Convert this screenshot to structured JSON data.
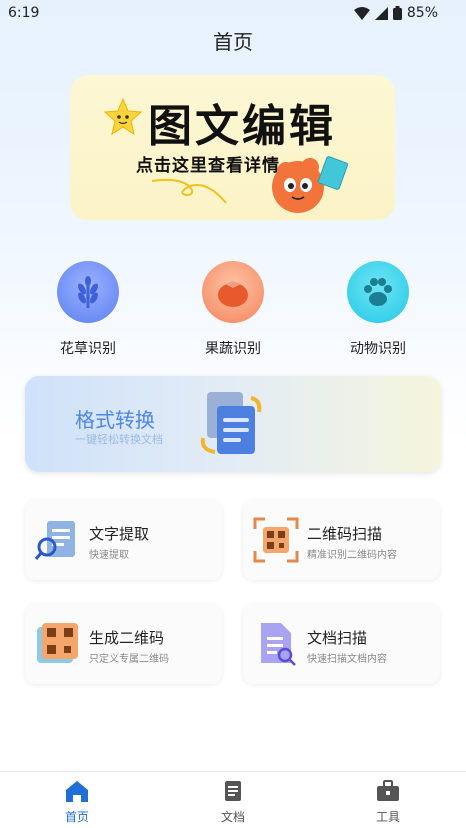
{
  "status_bar": {
    "time": "6:19",
    "battery": "85%"
  },
  "header": {
    "title": "首页"
  },
  "banner": {
    "title": "图文编辑",
    "subtitle": "点击这里查看详情"
  },
  "categories": [
    {
      "label": "花草识别",
      "icon": "wheat-icon",
      "color": "#5b7ff0"
    },
    {
      "label": "果蔬识别",
      "icon": "tomato-icon",
      "color": "#f3845b"
    },
    {
      "label": "动物识别",
      "icon": "paw-icon",
      "color": "#22c9e6"
    }
  ],
  "format_card": {
    "title": "格式转换",
    "subtitle": "一键轻松转换文档"
  },
  "tools": [
    {
      "title": "文字提取",
      "desc": "快速提取",
      "icon": "document-search-icon"
    },
    {
      "title": "二维码扫描",
      "desc": "精准识别二维码内容",
      "icon": "qr-scan-icon"
    },
    {
      "title": "生成二维码",
      "desc": "只定义专属二维码",
      "icon": "qr-code-icon"
    },
    {
      "title": "文档扫描",
      "desc": "快速扫描文档内容",
      "icon": "document-scan-icon"
    }
  ],
  "bottom_nav": [
    {
      "label": "首页",
      "icon": "home-icon",
      "active": true
    },
    {
      "label": "文档",
      "icon": "document-icon",
      "active": false
    },
    {
      "label": "工具",
      "icon": "toolbox-icon",
      "active": false
    }
  ],
  "colors": {
    "accent": "#1f6fd6",
    "inactive": "#555555"
  }
}
